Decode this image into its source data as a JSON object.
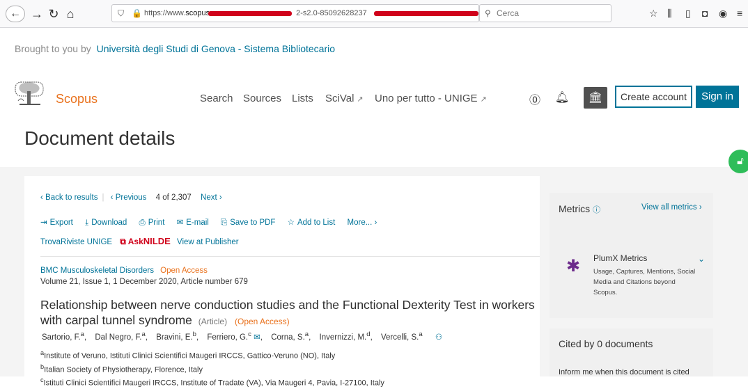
{
  "browser": {
    "url_prefix": "https://www.",
    "url_domain": "scopus",
    "url_visible_fragment": "2-s2.0-85092628237",
    "search_placeholder": "Cerca"
  },
  "brought": {
    "prefix": "Brought to you by",
    "institution": "Università degli Studi di Genova - Sistema Bibliotecario"
  },
  "header": {
    "logo": "Scopus",
    "nav": [
      {
        "label": "Search"
      },
      {
        "label": "Sources"
      },
      {
        "label": "Lists"
      },
      {
        "label": "SciVal",
        "ext": "↗"
      },
      {
        "label": "Uno per tutto - UNIGE",
        "ext": "↗"
      }
    ],
    "create_account": "Create account",
    "sign_in": "Sign in"
  },
  "page_title": "Document details",
  "navigation": {
    "back": "Back to results",
    "previous": "Previous",
    "position": "4",
    "of": "of",
    "total": "2,307",
    "next": "Next"
  },
  "actions": [
    "Export",
    "Download",
    "Print",
    "E-mail",
    "Save to PDF",
    "Add to List",
    "More..."
  ],
  "links": {
    "trova": "TrovaRiviste UNIGE",
    "nilde_ask": "Ask",
    "nilde": "NILDE",
    "publisher": "View at Publisher"
  },
  "document": {
    "journal": "BMC Musculoskeletal Disorders",
    "open_access": "Open Access",
    "volume": "Volume 21, Issue 1, 1 December 2020, Article number 679",
    "title": "Relationship between nerve conduction studies and the Functional Dexterity Test in workers with carpal tunnel syndrome",
    "type": "(Article)",
    "oa_tag": "(Open Access)",
    "authors": [
      {
        "name": "Sartorio, F.",
        "sup": "a"
      },
      {
        "name": "Dal Negro, F.",
        "sup": "a"
      },
      {
        "name": "Bravini, E.",
        "sup": "b"
      },
      {
        "name": "Ferriero, G.",
        "sup": "c"
      },
      {
        "name": "Corna, S.",
        "sup": "a"
      },
      {
        "name": "Invernizzi, M.",
        "sup": "d"
      },
      {
        "name": "Vercelli, S.",
        "sup": "a"
      }
    ],
    "affiliations": [
      {
        "sup": "a",
        "text": "Institute of Veruno, Istituti Clinici Scientifici Maugeri IRCCS, Gattico-Veruno (NO), Italy"
      },
      {
        "sup": "b",
        "text": "Italian Society of Physiotherapy, Florence, Italy"
      },
      {
        "sup": "c",
        "text": "Istituti Clinici Scientifici Maugeri IRCCS, Institute of Tradate (VA), Via Maugeri 4, Pavia, I-27100, Italy"
      }
    ]
  },
  "metrics": {
    "title": "Metrics",
    "view_all": "View all metrics",
    "plumx_title": "PlumX Metrics",
    "plumx_desc": "Usage, Captures, Mentions, Social Media and Citations beyond Scopus."
  },
  "cited": {
    "title": "Cited by 0 documents",
    "desc": "Inform me when this document is cited"
  },
  "colors": {
    "accent": "#007398",
    "scopus_orange": "#e9711c",
    "nilde_red": "#d0021b",
    "lock_green": "#2ebd59"
  }
}
